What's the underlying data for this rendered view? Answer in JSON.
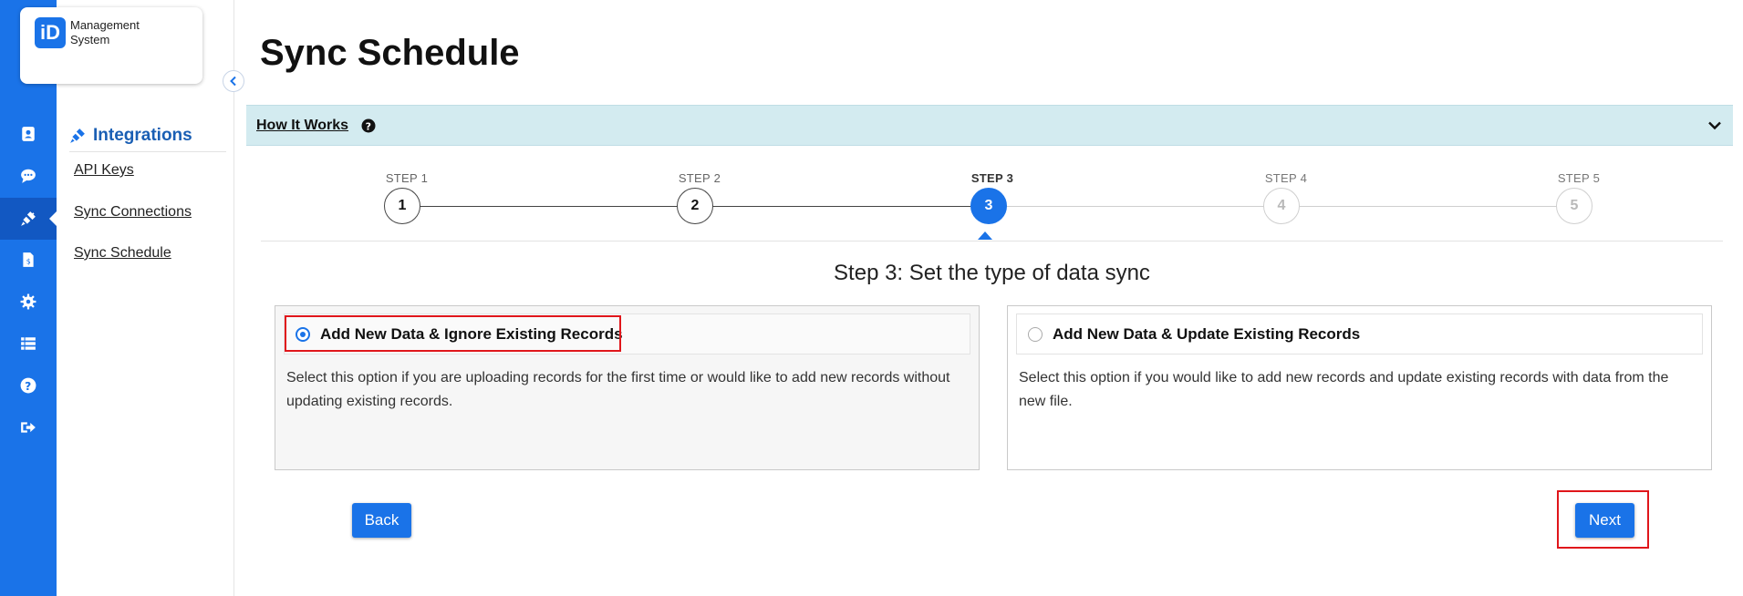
{
  "brand": {
    "logo_mark": "iD",
    "logo_line1": "Management",
    "logo_line2": "System"
  },
  "rail": {
    "icons": [
      "contact-card-icon",
      "chat-icon",
      "plug-icon",
      "invoice-icon",
      "gear-icon",
      "list-icon",
      "help-icon",
      "logout-icon"
    ],
    "active_index": 2
  },
  "sidebar": {
    "section_title": "Integrations",
    "links": [
      {
        "label": "API Keys"
      },
      {
        "label": "Sync Connections"
      },
      {
        "label": "Sync Schedule"
      }
    ]
  },
  "page": {
    "title": "Sync Schedule"
  },
  "how_it_works": {
    "label": "How It Works"
  },
  "stepper": {
    "current_step": 3,
    "steps": [
      {
        "label": "STEP 1",
        "number": "1"
      },
      {
        "label": "STEP 2",
        "number": "2"
      },
      {
        "label": "STEP 3",
        "number": "3"
      },
      {
        "label": "STEP 4",
        "number": "4"
      },
      {
        "label": "STEP 5",
        "number": "5"
      }
    ]
  },
  "step_heading": "Step 3: Set the type of data sync",
  "options": [
    {
      "title": "Add New Data & Ignore Existing Records",
      "description": "Select this option if you are uploading records for the first time or would like to add new records without updating existing records.",
      "selected": true
    },
    {
      "title": "Add New Data & Update Existing Records",
      "description": "Select this option if you would like to add new records and update existing records with data from the new file.",
      "selected": false
    }
  ],
  "actions": {
    "back_label": "Back",
    "next_label": "Next"
  },
  "colors": {
    "primary": "#1a73e8",
    "banner": "#d3ebf0",
    "highlight": "#e0161b"
  }
}
